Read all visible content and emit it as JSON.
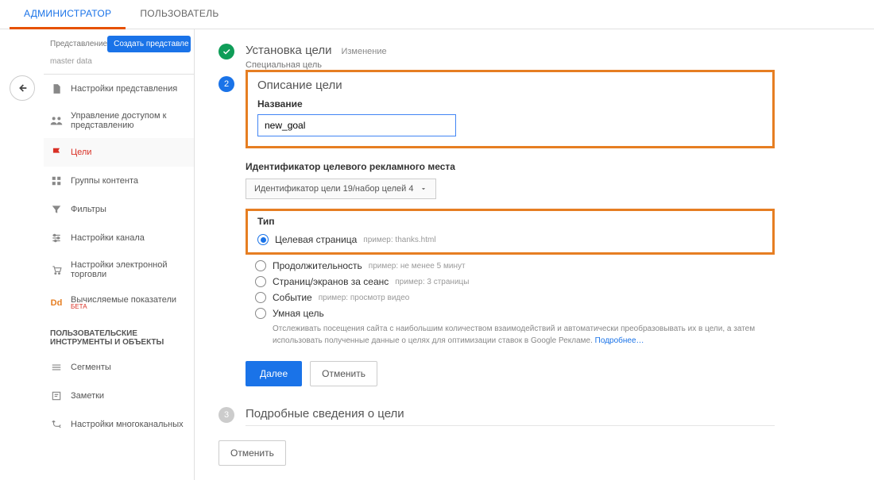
{
  "tabs": {
    "admin": "АДМИНИСТРАТОР",
    "user": "ПОЛЬЗОВАТЕЛЬ"
  },
  "sidebar": {
    "header_label": "Представление",
    "create_btn": "Создать представле",
    "subtitle": "master data",
    "items": [
      {
        "label": "Настройки представления"
      },
      {
        "label": "Управление доступом к представлению"
      },
      {
        "label": "Цели"
      },
      {
        "label": "Группы контента"
      },
      {
        "label": "Фильтры"
      },
      {
        "label": "Настройки канала"
      },
      {
        "label": "Настройки электронной торговли"
      },
      {
        "label": "Вычисляемые показатели",
        "badge": "БЕТА"
      }
    ],
    "section_header": "ПОЛЬЗОВАТЕЛЬСКИЕ ИНСТРУМЕНТЫ И ОБЪЕКТЫ",
    "tools": [
      {
        "label": "Сегменты"
      },
      {
        "label": "Заметки"
      },
      {
        "label": "Настройки многоканальных"
      }
    ]
  },
  "steps": {
    "s1": {
      "title": "Установка цели",
      "edit": "Изменение",
      "caption": "Специальная цель"
    },
    "s2": {
      "title": "Описание цели",
      "name_label": "Название",
      "name_value": "new_goal",
      "slot_label": "Идентификатор целевого рекламного места",
      "slot_value": "Идентификатор цели 19/набор целей 4",
      "type_label": "Тип",
      "options": [
        {
          "label": "Целевая страница",
          "hint": "пример: thanks.html"
        },
        {
          "label": "Продолжительность",
          "hint": "пример: не менее 5 минут"
        },
        {
          "label": "Страниц/экранов за сеанс",
          "hint": "пример: 3 страницы"
        },
        {
          "label": "Событие",
          "hint": "пример: просмотр видео"
        },
        {
          "label": "Умная цель",
          "hint": ""
        }
      ],
      "smart_help": "Отслеживать посещения сайта с наибольшим количеством взаимодействий и автоматически преобразовывать их в цели, а затем использовать полученные данные о целях для оптимизации ставок в Google Рекламе.",
      "smart_link": "Подробнее…",
      "btn_next": "Далее",
      "btn_cancel": "Отменить"
    },
    "s3": {
      "title": "Подробные сведения о цели"
    }
  },
  "bottom_cancel": "Отменить"
}
